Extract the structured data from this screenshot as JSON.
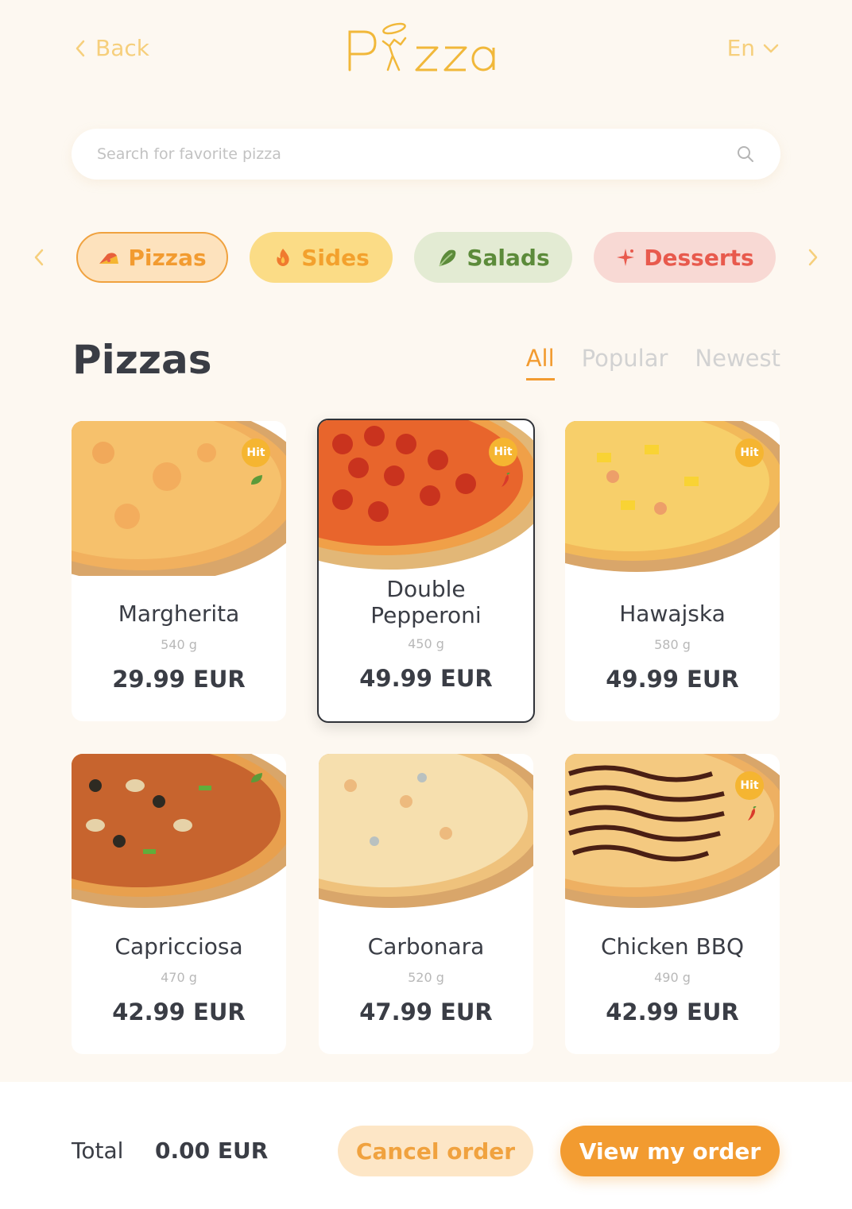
{
  "header": {
    "back_label": "Back",
    "logo": "Pizza",
    "language": "En"
  },
  "search": {
    "placeholder": "Search for favorite pizza"
  },
  "categories": [
    {
      "label": "Pizzas",
      "icon": "pizza-slice-icon",
      "color": "#f29b30"
    },
    {
      "label": "Sides",
      "icon": "fire-icon",
      "color": "#f3a12d"
    },
    {
      "label": "Salads",
      "icon": "lettuce-icon",
      "color": "#5c8b3a"
    },
    {
      "label": "Desserts",
      "icon": "sparkle-icon",
      "color": "#e85a4d"
    }
  ],
  "section": {
    "title": "Pizzas",
    "filters": [
      "All",
      "Popular",
      "Newest"
    ],
    "active_filter": "All"
  },
  "products": [
    {
      "name": "Margherita",
      "weight": "540 g",
      "price": "29.99 EUR",
      "badge": "Hit",
      "tag_icon": "leaf-icon",
      "selected": false
    },
    {
      "name": "Double Pepperoni",
      "weight": "450 g",
      "price": "49.99 EUR",
      "badge": "Hit",
      "tag_icon": "chili-icon",
      "selected": true
    },
    {
      "name": "Hawajska",
      "weight": "580 g",
      "price": "49.99 EUR",
      "badge": "Hit",
      "tag_icon": "",
      "selected": false
    },
    {
      "name": "Capricciosa",
      "weight": "470 g",
      "price": "42.99 EUR",
      "badge": "",
      "tag_icon": "leaf-icon",
      "selected": false
    },
    {
      "name": "Carbonara",
      "weight": "520 g",
      "price": "47.99 EUR",
      "badge": "",
      "tag_icon": "",
      "selected": false
    },
    {
      "name": "Chicken BBQ",
      "weight": "490 g",
      "price": "42.99 EUR",
      "badge": "Hit",
      "tag_icon": "chili-icon",
      "selected": false
    }
  ],
  "footer": {
    "total_label": "Total",
    "total_value": "0.00 EUR",
    "cancel_label": "Cancel order",
    "view_label": "View my order"
  },
  "colors": {
    "accent": "#f29b30",
    "background": "#fdf8f1",
    "logo": "#f1b83a",
    "badge": "#f5b531"
  }
}
